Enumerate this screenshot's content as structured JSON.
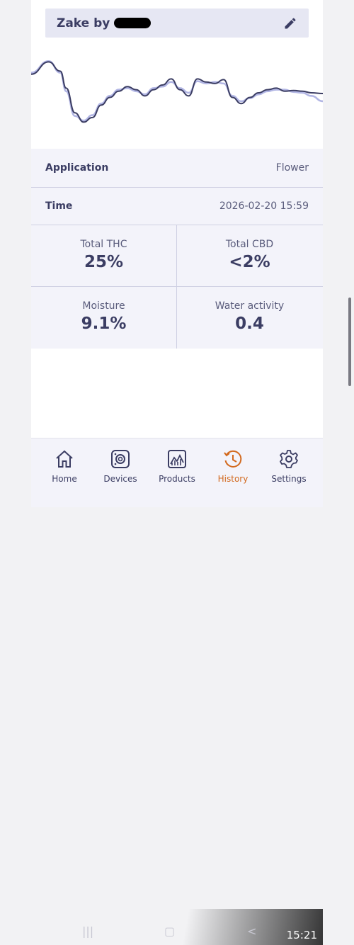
{
  "header": {
    "title": "Zake by"
  },
  "chart_data": {
    "type": "line",
    "title": "",
    "xlabel": "",
    "ylabel": "",
    "ylim": [
      0,
      100
    ],
    "xlim": [
      0,
      100
    ],
    "grid": false,
    "series": [
      {
        "color": "#3b3d63",
        "x": [
          0,
          6,
          10,
          12,
          15,
          18,
          21,
          24,
          27,
          30,
          33,
          36,
          39,
          42,
          45,
          48,
          51,
          54,
          57,
          60,
          63,
          66,
          69,
          72,
          75,
          78,
          81,
          84,
          87,
          90,
          93,
          96,
          100
        ],
        "y": [
          80,
          96,
          84,
          62,
          30,
          18,
          24,
          40,
          50,
          58,
          64,
          60,
          52,
          60,
          66,
          74,
          60,
          52,
          74,
          70,
          68,
          73,
          50,
          42,
          50,
          56,
          60,
          62,
          58,
          59,
          58,
          56,
          55
        ]
      },
      {
        "color": "#b2b6e4",
        "x": [
          0,
          6,
          10,
          12,
          15,
          18,
          21,
          24,
          27,
          30,
          33,
          36,
          39,
          42,
          45,
          48,
          51,
          54,
          57,
          60,
          63,
          66,
          69,
          72,
          75,
          78,
          81,
          84,
          87,
          90,
          93,
          96,
          100
        ],
        "y": [
          82,
          97,
          82,
          58,
          26,
          20,
          27,
          42,
          52,
          60,
          62,
          58,
          54,
          62,
          64,
          70,
          62,
          56,
          71,
          68,
          70,
          68,
          52,
          45,
          49,
          54,
          58,
          60,
          60,
          57,
          56,
          52,
          45
        ]
      }
    ]
  },
  "details": {
    "application": {
      "label": "Application",
      "value": "Flower"
    },
    "time": {
      "label": "Time",
      "value": "2026-02-20 15:59"
    }
  },
  "metrics": [
    {
      "label": "Total THC",
      "value": "25%"
    },
    {
      "label": "Total CBD",
      "value": "<2%"
    },
    {
      "label": "Moisture",
      "value": "9.1%"
    },
    {
      "label": "Water activity",
      "value": "0.4"
    }
  ],
  "nav": {
    "items": [
      {
        "label": "Home",
        "icon": "home-icon"
      },
      {
        "label": "Devices",
        "icon": "device-icon"
      },
      {
        "label": "Products",
        "icon": "chart-icon"
      },
      {
        "label": "History",
        "icon": "history-icon"
      },
      {
        "label": "Settings",
        "icon": "gear-icon"
      }
    ],
    "active": "History"
  },
  "system": {
    "clock": "15:21"
  },
  "colors": {
    "primary": "#3b3d63",
    "accent": "#d2691e",
    "panel": "#f3f3fa",
    "header": "#e6e7f3"
  }
}
